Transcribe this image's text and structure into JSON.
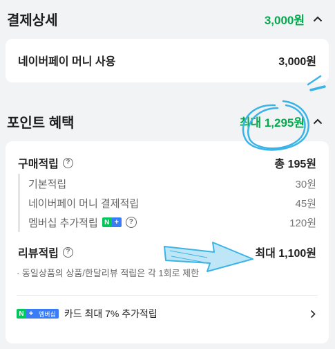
{
  "payment": {
    "title": "결제상세",
    "total": "3,000원",
    "method_label": "네이버페이 머니 사용",
    "method_amount": "3,000원"
  },
  "points": {
    "title": "포인트 혜택",
    "max_total": "최대 1,295원",
    "purchase": {
      "label": "구매적립",
      "total": "총 195원",
      "items": [
        {
          "label": "기본적립",
          "value": "30원"
        },
        {
          "label": "네이버페이 머니 결제적립",
          "value": "45원"
        },
        {
          "label": "멤버십 추가적립",
          "value": "120원"
        }
      ]
    },
    "review": {
      "label": "리뷰적립",
      "total": "최대 1,100원",
      "note": "· 동일상품의 상품/한달리뷰 적립은 각 1회로 제한"
    },
    "card_promo": {
      "badge_text": "멤버십",
      "label": "카드 최대 7% 추가적립"
    }
  },
  "colors": {
    "accent_green": "#03a94d",
    "npay_green": "#03c75a",
    "npay_blue": "#3a7bf6",
    "annotation_blue": "#3ab3e6"
  },
  "icons": [
    "chevron-up-icon",
    "question-icon",
    "npay-plus-badge",
    "chevron-right-icon"
  ]
}
